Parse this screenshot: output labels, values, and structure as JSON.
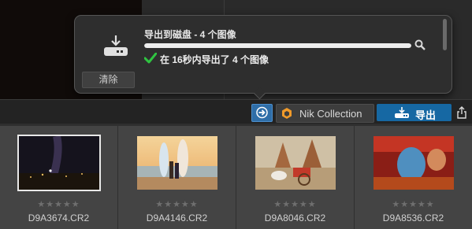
{
  "popover": {
    "title": "导出到磁盘 - 4 个图像",
    "progress": 1.0,
    "status": "在 16秒内导出了 4 个图像",
    "clear_label": "清除",
    "icons": {
      "disk": "disk-drive-icon",
      "reveal": "magnifier-icon",
      "done": "checkmark-icon"
    },
    "check_color": "#2fc441"
  },
  "toolbar": {
    "nik_label": "Nik Collection",
    "export_label": "导出",
    "accent": "#1668a3"
  },
  "filmstrip": {
    "items": [
      {
        "name": "D9A3674.CR2",
        "stars": "★★★★★",
        "rating": 0,
        "selected": true
      },
      {
        "name": "D9A4146.CR2",
        "stars": "★★★★★",
        "rating": 0,
        "selected": false
      },
      {
        "name": "D9A8046.CR2",
        "stars": "★★★★★",
        "rating": 0,
        "selected": false
      },
      {
        "name": "D9A8536.CR2",
        "stars": "★★★★★",
        "rating": 0,
        "selected": false
      }
    ]
  }
}
